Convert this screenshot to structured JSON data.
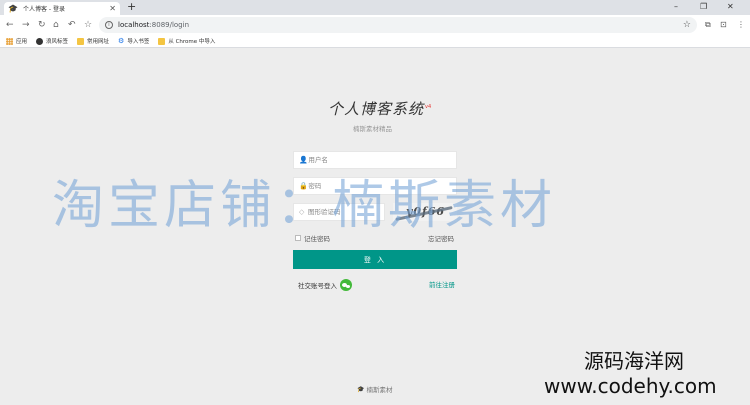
{
  "browser": {
    "tab_title": "个人博客 - 登录",
    "new_tab": "+",
    "address": {
      "host": "localhost",
      "path": ":8089/login"
    },
    "window_controls": {
      "minimize": "–",
      "maximize": "❐",
      "close": "✕"
    },
    "bookmarks": [
      {
        "icon": "apps-icon",
        "label": "应用"
      },
      {
        "icon": "globe-icon",
        "label": "浪风标签"
      },
      {
        "icon": "folder-icon",
        "label": "常用网址"
      },
      {
        "icon": "gear-icon",
        "label": "导入书签"
      },
      {
        "icon": "folder-icon",
        "label": "从 Chrome 中导入"
      }
    ]
  },
  "login": {
    "title": "个人博客系统",
    "version": "v4",
    "subtitle": "楠斯素材精品",
    "username_placeholder": "用户名",
    "password_placeholder": "密码",
    "captcha_placeholder": "图形验证码",
    "captcha_text": "y0f66",
    "remember_label": "记住密码",
    "forgot_label": "忘记密码",
    "login_button": "登 入",
    "social_label": "社交账号登入",
    "register_label": "前往注册",
    "footer": "楠斯素材"
  },
  "watermarks": {
    "center": "淘宝店铺：楠斯素材",
    "corner_line1": "源码海洋网",
    "corner_line2": "www.codehy.com"
  },
  "colors": {
    "primary": "#009688",
    "wechat": "#43b93a",
    "page_background": "#ededed"
  }
}
